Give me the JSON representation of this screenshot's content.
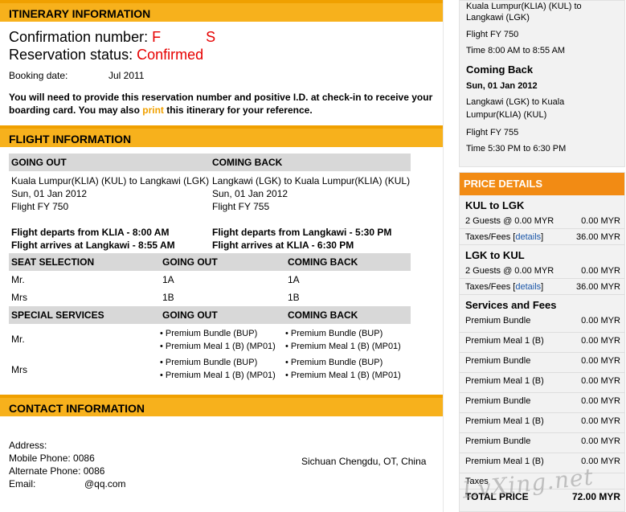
{
  "itinerary": {
    "header": "ITINERARY INFORMATION",
    "confirmation_label": "Confirmation number:",
    "confirmation_value_a": "F",
    "confirmation_value_b": "S",
    "status_label": "Reservation status:",
    "status_value": "Confirmed",
    "booking_label": "Booking date:",
    "booking_value": "Jul 2011",
    "notice_pre": "You will need to provide this reservation number and positive I.D. at check-in to receive your boarding card. You may also ",
    "notice_link": "print",
    "notice_post": " this itinerary for your reference."
  },
  "flight": {
    "header": "FLIGHT INFORMATION",
    "going_out": {
      "title": "GOING OUT",
      "route": "Kuala Lumpur(KLIA) (KUL) to Langkawi (LGK)",
      "date": "Sun, 01 Jan 2012",
      "flight": "Flight FY 750",
      "departs": "Flight departs from KLIA - 8:00 AM",
      "arrives": "Flight arrives at Langkawi - 8:55 AM"
    },
    "coming_back": {
      "title": "COMING BACK",
      "route": "Langkawi (LGK) to Kuala Lumpur(KLIA) (KUL)",
      "date": "Sun, 01 Jan 2012",
      "flight": "Flight FY 755",
      "departs": "Flight departs from Langkawi - 5:30 PM",
      "arrives": "Flight arrives at KLIA - 6:30 PM"
    }
  },
  "seats": {
    "headers": [
      "SEAT SELECTION",
      "GOING OUT",
      "COMING BACK"
    ],
    "rows": [
      {
        "name": "Mr.",
        "out": "1A",
        "back": "1A"
      },
      {
        "name": "Mrs",
        "out": "1B",
        "back": "1B"
      }
    ]
  },
  "services": {
    "headers": [
      "SPECIAL SERVICES",
      "GOING OUT",
      "COMING BACK"
    ],
    "rows": [
      {
        "name": "Mr.",
        "out": [
          "Premium Bundle (BUP)",
          "Premium Meal 1 (B) (MP01)"
        ],
        "back": [
          "Premium Bundle (BUP)",
          "Premium Meal 1 (B) (MP01)"
        ]
      },
      {
        "name": "Mrs",
        "out": [
          "Premium Bundle (BUP)",
          "Premium Meal 1 (B) (MP01)"
        ],
        "back": [
          "Premium Bundle (BUP)",
          "Premium Meal 1 (B) (MP01)"
        ]
      }
    ]
  },
  "contact": {
    "header": "CONTACT INFORMATION",
    "address_label": "Address:",
    "address_value": "Sichuan Chengdu, OT, China",
    "mobile": "Mobile Phone: 0086",
    "alternate": "Alternate Phone: 0086",
    "email_label": "Email:",
    "email_value": "@qq.com"
  },
  "summary": {
    "out_route": "Kuala Lumpur(KLIA) (KUL) to Langkawi (LGK)",
    "out_flight": "Flight FY 750",
    "out_time": "Time 8:00 AM to 8:55 AM",
    "back_title": "Coming Back",
    "back_date": "Sun, 01 Jan 2012",
    "back_route": "Langkawi (LGK) to Kuala Lumpur(KLIA) (KUL)",
    "back_flight": "Flight FY 755",
    "back_time": "Time 5:30 PM to 6:30 PM"
  },
  "price": {
    "header": "PRICE DETAILS",
    "kul_lgk": {
      "title": "KUL to LGK",
      "guests": "2 Guests @ 0.00 MYR",
      "guests_val": "0.00 MYR",
      "taxes_pre": "Taxes/Fees [",
      "taxes_link": "details",
      "taxes_post": "]",
      "taxes_val": "36.00 MYR"
    },
    "lgk_kul": {
      "title": "LGK to KUL",
      "guests": "2 Guests @ 0.00 MYR",
      "guests_val": "0.00 MYR",
      "taxes_pre": "Taxes/Fees [",
      "taxes_link": "details",
      "taxes_post": "]",
      "taxes_val": "36.00 MYR"
    },
    "services_title": "Services and Fees",
    "services": [
      {
        "label": "Premium Bundle",
        "value": "0.00 MYR"
      },
      {
        "label": "Premium Meal 1 (B)",
        "value": "0.00 MYR"
      },
      {
        "label": "Premium Bundle",
        "value": "0.00 MYR"
      },
      {
        "label": "Premium Meal 1 (B)",
        "value": "0.00 MYR"
      },
      {
        "label": "Premium Bundle",
        "value": "0.00 MYR"
      },
      {
        "label": "Premium Meal 1 (B)",
        "value": "0.00 MYR"
      },
      {
        "label": "Premium Bundle",
        "value": "0.00 MYR"
      },
      {
        "label": "Premium Meal 1 (B)",
        "value": "0.00 MYR"
      }
    ],
    "taxes_label": "Taxes",
    "total_label": "TOTAL PRICE",
    "total_value": "72.00 MYR"
  },
  "watermark": "LvXing.net"
}
